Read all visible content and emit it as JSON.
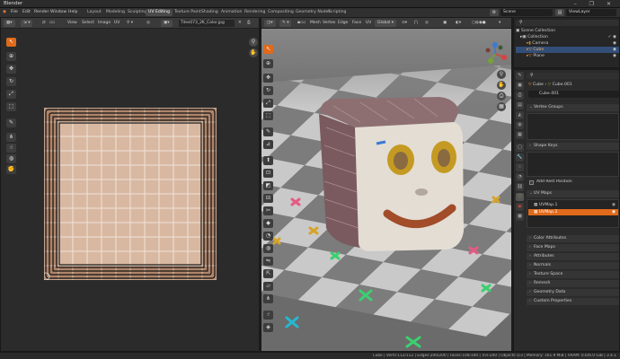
{
  "window": {
    "title": "Blender",
    "controls": "–  ❐  ✕"
  },
  "menu": {
    "items": [
      "File",
      "Edit",
      "Render",
      "Window",
      "Help"
    ]
  },
  "workspaces": [
    "Layout",
    "Modeling",
    "Sculpting",
    "UV Editing",
    "Texture Paint",
    "Shading",
    "Animation",
    "Rendering",
    "Compositing",
    "Geometry Nodes",
    "Scripting"
  ],
  "active_workspace": "UV Editing",
  "scene": {
    "scene_label": "Scene",
    "view_layer_label": "ViewLayer"
  },
  "uv_editor": {
    "header": [
      "View",
      "Select",
      "Image",
      "UV"
    ],
    "image_name": "Tiles073_2K_Color.jpg"
  },
  "viewport": {
    "header": [
      "Mesh",
      "Vertex",
      "Edge",
      "Face",
      "UV"
    ],
    "orientation": "Global",
    "options_label": "Options"
  },
  "outliner": {
    "rows": [
      {
        "label": "Scene Collection",
        "icon": "collection-icon"
      },
      {
        "label": "Collection",
        "icon": "collection-icon"
      },
      {
        "label": "Camera",
        "icon": "camera-icon"
      },
      {
        "label": "Cube",
        "icon": "mesh-icon"
      },
      {
        "label": "Plane",
        "icon": "mesh-icon"
      }
    ],
    "selected": "Cube"
  },
  "properties": {
    "object_name": "Cube",
    "mesh_name": "Cube.001",
    "mesh_field": "Cube.001",
    "panels": {
      "vertex_groups": "Vertex Groups",
      "shape_keys": "Shape Keys",
      "add_rest_position": "Add Rest Position",
      "uv_maps": "UV Maps",
      "uv_map_items": [
        "UVMap.1",
        "UVMap.2"
      ],
      "color_attributes": "Color Attributes",
      "face_maps": "Face Maps",
      "attributes": "Attributes",
      "normals": "Normals",
      "texture_space": "Texture Space",
      "remesh": "Remesh",
      "geometry_data": "Geometry Data",
      "custom_properties": "Custom Properties"
    }
  },
  "status": {
    "text": "Cube | Verts:112/112 | Edges:200/200 | Faces:100/100 | Tris:200 | Objects:1/3 | Memory: 161.9 MiB | VRAM: 0.6/6.0 GiB | 3.4.1"
  },
  "colors": {
    "accent": "#e06a1b",
    "selected_row": "#e06a1b",
    "checker_light": "#c9c9c9",
    "checker_dark": "#7c7c7c"
  }
}
